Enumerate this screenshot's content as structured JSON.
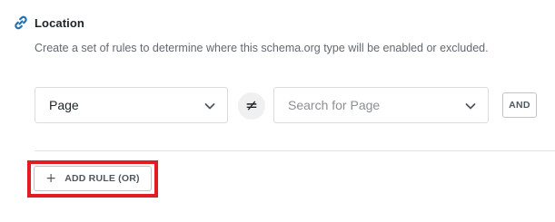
{
  "location": {
    "title": "Location",
    "description": "Create a set of rules to determine where this schema.org type will be enabled or excluded.",
    "icon": "link-icon",
    "accent_color": "#2271b1"
  },
  "rule": {
    "type_select": {
      "value": "Page"
    },
    "operator": {
      "symbol": "≠",
      "meaning": "not-equal"
    },
    "search_select": {
      "placeholder": "Search for Page"
    },
    "and_label": "AND"
  },
  "add_rule": {
    "label": "ADD RULE (OR)",
    "icon": "plus-icon",
    "highlight_color": "#e31b23"
  }
}
